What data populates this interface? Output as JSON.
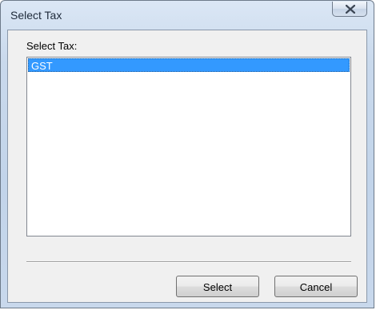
{
  "window": {
    "title": "Select Tax"
  },
  "dialog": {
    "label": "Select Tax:",
    "list": {
      "items": [
        "GST"
      ],
      "selected": "GST"
    },
    "buttons": {
      "select_label": "Select",
      "cancel_label": "Cancel"
    }
  },
  "colors": {
    "selection": "#3399ff",
    "selection_text": "#ffffff",
    "client_background": "#f0f0f0",
    "titlebar": "#c9d9ec"
  },
  "icons": {
    "close": "close-icon"
  }
}
